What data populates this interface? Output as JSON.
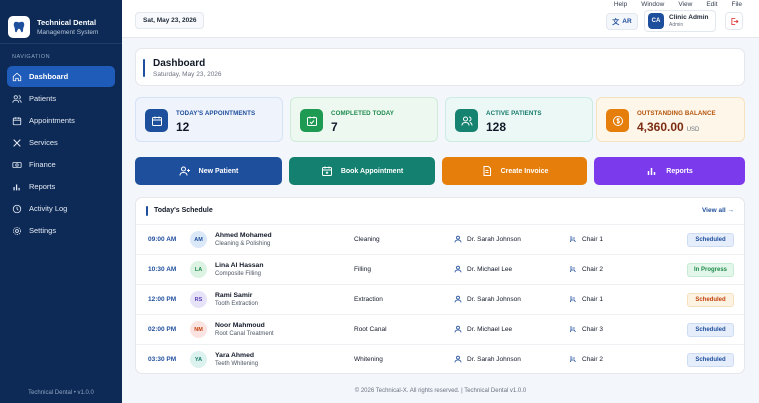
{
  "menubar": [
    "Help",
    "Window",
    "View",
    "Edit",
    "File"
  ],
  "brand": {
    "title": "Technical Dental",
    "subtitle": "Management System"
  },
  "sidebar": {
    "heading": "NAVIGATION",
    "items": [
      {
        "label": "Dashboard",
        "icon": "home-icon",
        "active": true
      },
      {
        "label": "Patients",
        "icon": "users-icon"
      },
      {
        "label": "Appointments",
        "icon": "calendar-icon"
      },
      {
        "label": "Services",
        "icon": "tools-icon"
      },
      {
        "label": "Finance",
        "icon": "money-icon"
      },
      {
        "label": "Reports",
        "icon": "bar-chart-icon"
      },
      {
        "label": "Activity Log",
        "icon": "clock-icon"
      },
      {
        "label": "Settings",
        "icon": "gear-icon"
      }
    ],
    "footer": "Technical Dental  •  v1.0.0"
  },
  "topbar": {
    "date": "Sat, May 23, 2026",
    "lang": "AR",
    "user_initials": "CA",
    "user_name": "Clinic Admin",
    "user_role": "Admin"
  },
  "dashboard": {
    "title": "Dashboard",
    "date": "Saturday, May 23, 2026"
  },
  "stats": [
    {
      "label": "TODAY'S APPOINTMENTS",
      "value": "12",
      "unit": "",
      "color": "#1f4e9c"
    },
    {
      "label": "COMPLETED TODAY",
      "value": "7",
      "unit": "",
      "color": "#1f8a4c"
    },
    {
      "label": "ACTIVE PATIENTS",
      "value": "128",
      "unit": "",
      "color": "#137a6b"
    },
    {
      "label": "OUTSTANDING BALANCE",
      "value": "4,360.00",
      "unit": "USD",
      "color": "#b45309"
    }
  ],
  "actions": [
    {
      "label": "New Patient",
      "color": "#1e4f9c"
    },
    {
      "label": "Book Appointment",
      "color": "#14806f"
    },
    {
      "label": "Create Invoice",
      "color": "#e67e0b"
    },
    {
      "label": "Reports",
      "color": "#7c3aed"
    }
  ],
  "schedule": {
    "title": "Today's Schedule",
    "view_all": "View all →",
    "rows": [
      {
        "time": "09:00 AM",
        "initials": "AM",
        "name": "Ahmed Mohamed",
        "procedure": "Cleaning & Polishing",
        "service": "Cleaning",
        "doctor": "Dr. Sarah Johnson",
        "chair": "Chair 1",
        "status": "Scheduled"
      },
      {
        "time": "10:30 AM",
        "initials": "LA",
        "name": "Lina Al Hassan",
        "procedure": "Composite Filling",
        "service": "Filling",
        "doctor": "Dr. Michael Lee",
        "chair": "Chair 2",
        "status": "In Progress"
      },
      {
        "time": "12:00 PM",
        "initials": "RS",
        "name": "Rami Samir",
        "procedure": "Tooth Extraction",
        "service": "Extraction",
        "doctor": "Dr. Sarah Johnson",
        "chair": "Chair 1",
        "status": "Scheduled"
      },
      {
        "time": "02:00 PM",
        "initials": "NM",
        "name": "Noor Mahmoud",
        "procedure": "Root Canal Treatment",
        "service": "Root Canal",
        "doctor": "Dr. Michael Lee",
        "chair": "Chair 3",
        "status": "Scheduled"
      },
      {
        "time": "03:30 PM",
        "initials": "YA",
        "name": "Yara Ahmed",
        "procedure": "Teeth Whitening",
        "service": "Whitening",
        "doctor": "Dr. Sarah Johnson",
        "chair": "Chair 2",
        "status": "Scheduled"
      }
    ]
  },
  "footer": "© 2026 Technical-X. All rights reserved. | Technical Dental v1.0.0"
}
